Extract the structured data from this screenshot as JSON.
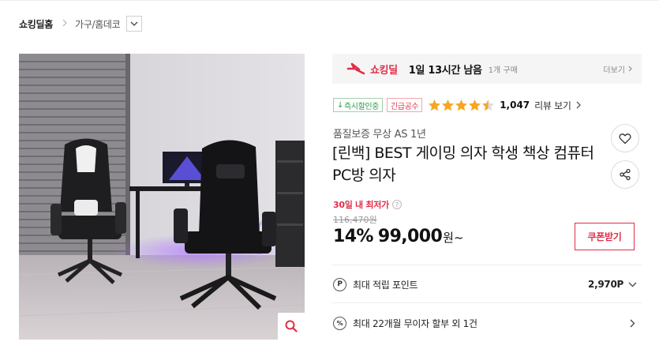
{
  "breadcrumb": {
    "home": "쇼킹딜홈",
    "category": "가구/홈데코"
  },
  "deal": {
    "name": "쇼킹딜",
    "time_left": "1일 13시간 남음",
    "buyer_count": "1개 구매",
    "more": "더보기"
  },
  "badges": {
    "instant_discount": "즉시할인중",
    "urgent": "긴급공수"
  },
  "rating": {
    "stars": 4.5,
    "review_count": "1,047",
    "review_link": "리뷰 보기"
  },
  "product": {
    "subtitle": "품질보증 무상 AS 1년",
    "title": "[린백] BEST 게이밍 의자 학생 책상 컴퓨터 PC방 의자"
  },
  "price": {
    "lowest_label": "30일 내 최저가",
    "original": "116,470원",
    "discount": "14%",
    "sale": "99,000",
    "unit": "원~",
    "coupon_button": "쿠폰받기"
  },
  "benefits": {
    "points_label": "최대 적립 포인트",
    "points_value": "2,970P",
    "installment_label": "최대 22개월 무이자 할부 외 1건"
  },
  "colors": {
    "accent": "#e02e48",
    "badge_green": "#2d9c4b",
    "star": "#f5a623"
  },
  "icons": [
    "chevron-right-icon",
    "chevron-down-icon",
    "flame-icon",
    "star-icon",
    "heart-icon",
    "share-icon",
    "search-icon",
    "point-icon",
    "percent-icon"
  ]
}
